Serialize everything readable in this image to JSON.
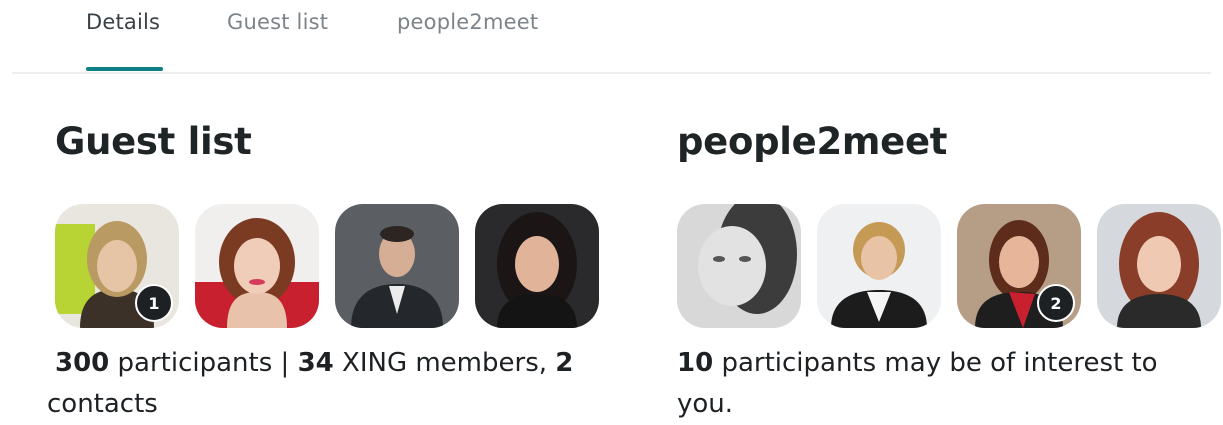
{
  "tabs": [
    {
      "label": "Details",
      "active": true
    },
    {
      "label": "Guest list",
      "active": false
    },
    {
      "label": "people2meet",
      "active": false
    }
  ],
  "guest_list": {
    "title": "Guest list",
    "badge_count": "1",
    "participants_count": "300",
    "participants_label": " participants | ",
    "members_count": "34",
    "members_label": " XING members, ",
    "contacts_count": "2",
    "contacts_label": " contacts"
  },
  "people2meet": {
    "title": "people2meet",
    "badge_count": "2",
    "count": "10",
    "text": " participants may be of interest to you."
  },
  "colors": {
    "accent": "#0d7f82",
    "tab_inactive": "#7c848a",
    "text": "#1d2124"
  }
}
